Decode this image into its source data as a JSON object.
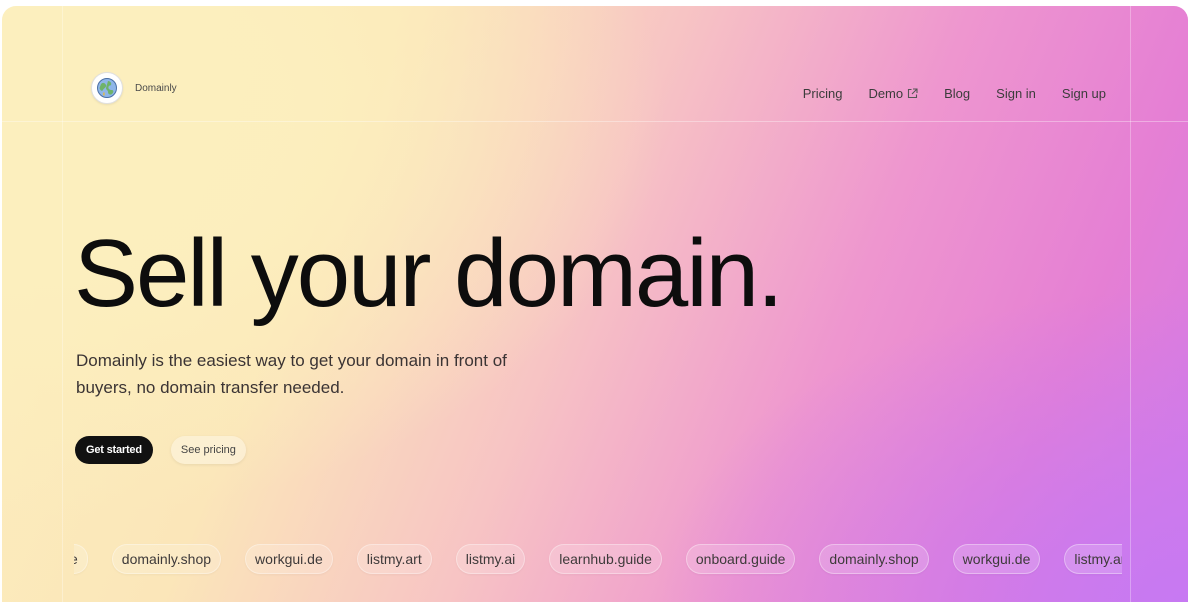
{
  "brand": {
    "name": "Domainly"
  },
  "nav": {
    "items": [
      {
        "label": "Pricing"
      },
      {
        "label": "Demo",
        "icon": "external-link-icon"
      },
      {
        "label": "Blog"
      },
      {
        "label": "Sign in"
      },
      {
        "label": "Sign up"
      }
    ]
  },
  "hero": {
    "title": "Sell your domain.",
    "subtitle": "Domainly is the easiest way to get your domain in front of buyers, no domain transfer needed.",
    "primary_cta": "Get started",
    "secondary_cta": "See pricing"
  },
  "domains": [
    "e",
    "domainly.shop",
    "workgui.de",
    "listmy.art",
    "listmy.ai",
    "learnhub.guide",
    "onboard.guide",
    "domainly.shop",
    "workgui.de",
    "listmy.art"
  ],
  "colors": {
    "gradient_start": "#fcefbe",
    "gradient_mid": "#ee96cf",
    "gradient_end": "#c779f2",
    "text_primary": "#0d0d0d",
    "button_primary": "#111111"
  }
}
